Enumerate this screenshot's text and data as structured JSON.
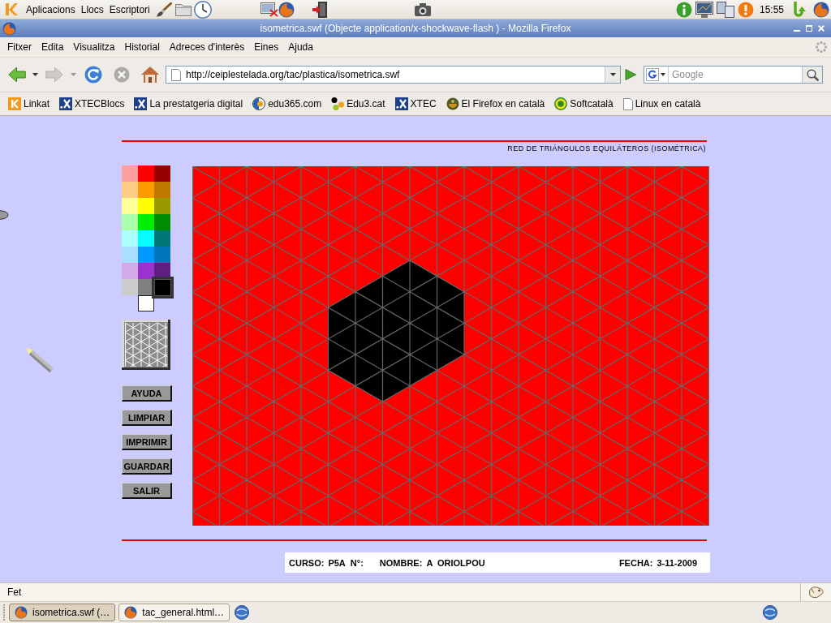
{
  "top_panel": {
    "menus": [
      "Aplicacions",
      "Llocs",
      "Escriptori"
    ],
    "clock": "15:55"
  },
  "window": {
    "title": "isometrica.swf (Objecte application/x-shockwave-flash ) - Mozilla Firefox"
  },
  "menu_bar": [
    "Fitxer",
    "Edita",
    "Visualitza",
    "Historial",
    "Adreces d'interès",
    "Eines",
    "Ajuda"
  ],
  "toolbar": [
    {
      "kind": "back",
      "disabled": false
    },
    {
      "kind": "forward",
      "disabled": true
    },
    {
      "kind": "reload",
      "disabled": false
    },
    {
      "kind": "stop",
      "disabled": true
    },
    {
      "kind": "home",
      "disabled": false
    }
  ],
  "address": {
    "url": "http://ceiplestelada.org/tac/plastica/isometrica.swf"
  },
  "search": {
    "placeholder": "Google"
  },
  "bookmarks": [
    {
      "label": "Linkat",
      "kind": "linkat"
    },
    {
      "label": "XTECBlocs",
      "kind": "xtec"
    },
    {
      "label": "La prestatgeria digital",
      "kind": "xtec"
    },
    {
      "label": "edu365.com",
      "kind": "edu365"
    },
    {
      "label": "Edu3.cat",
      "kind": "edu3"
    },
    {
      "label": "XTEC",
      "kind": "xtec"
    },
    {
      "label": "El Firefox en català",
      "kind": "firefox"
    },
    {
      "label": "Softcatalà",
      "kind": "softcatala"
    },
    {
      "label": "Linux en català",
      "kind": "page"
    }
  ],
  "page": {
    "title": "RED DE TRIÁNGULOS EQUILÁTEROS (ISOMÉTRICA)",
    "palette": [
      {
        "color": "#ffa0a0",
        "selected": false
      },
      {
        "color": "#ff0000",
        "selected": false
      },
      {
        "color": "#990000",
        "selected": false
      },
      {
        "color": "#ffcc88",
        "selected": false
      },
      {
        "color": "#ff9900",
        "selected": false
      },
      {
        "color": "#c07800",
        "selected": false
      },
      {
        "color": "#ffff99",
        "selected": false
      },
      {
        "color": "#ffff00",
        "selected": false
      },
      {
        "color": "#999900",
        "selected": false
      },
      {
        "color": "#aaffaa",
        "selected": false
      },
      {
        "color": "#00ee00",
        "selected": false
      },
      {
        "color": "#008c00",
        "selected": false
      },
      {
        "color": "#aaffff",
        "selected": false
      },
      {
        "color": "#00ffff",
        "selected": false
      },
      {
        "color": "#007878",
        "selected": false
      },
      {
        "color": "#aaddff",
        "selected": false
      },
      {
        "color": "#0099ff",
        "selected": false
      },
      {
        "color": "#0077bb",
        "selected": false
      },
      {
        "color": "#d2aae6",
        "selected": false
      },
      {
        "color": "#9933cc",
        "selected": false
      },
      {
        "color": "#5f1f80",
        "selected": false
      },
      {
        "color": "#cccccc",
        "selected": false
      },
      {
        "color": "#808080",
        "selected": false
      },
      {
        "color": "#000000",
        "selected": true
      },
      {
        "color": "#ffffff",
        "selected": false
      }
    ],
    "buttons": [
      "AYUDA",
      "LIMPIAR",
      "IMPRIMIR",
      "GUARDAR",
      "SALIR"
    ],
    "canvas": {
      "regions": [
        {
          "kind": "background",
          "color": "#ff0000"
        },
        {
          "kind": "hexagon",
          "color": "#000000"
        }
      ]
    },
    "info": [
      {
        "label": "CURSO:",
        "value": "P5A"
      },
      {
        "label": "N°:"
      },
      {
        "label": "NOMBRE:",
        "value": "A ORIOLPOU"
      },
      {
        "label": "FECHA:",
        "value": "3-11-2009"
      }
    ]
  },
  "status_bar": {
    "text": "Fet"
  },
  "taskbar": [
    {
      "label": "isometrica.swf (…",
      "selected": true
    },
    {
      "label": "tac_general.html…",
      "selected": false
    }
  ]
}
